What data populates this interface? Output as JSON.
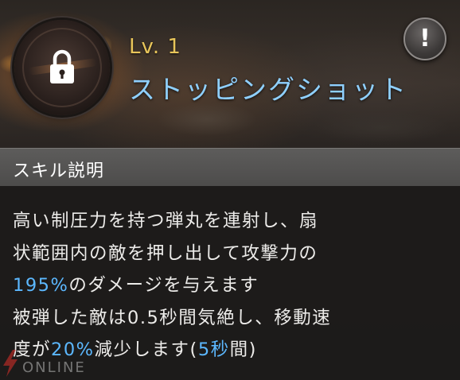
{
  "skill": {
    "level": "Lv. 1",
    "name": "ストッピングショット",
    "icon": "lock-icon",
    "locked": true
  },
  "info_button": {
    "label": "!",
    "icon": "exclamation-icon"
  },
  "section": {
    "header": "スキル説明"
  },
  "description": {
    "line1": "高い制圧力を持つ弾丸を連射し、扇",
    "line2": "状範囲内の敵を押し出して攻撃力の",
    "line3_value": "195%",
    "line3_rest": "のダメージを与えます",
    "line4": "被弾した敵は0.5秒間気絶し、移動速",
    "line5_pre": "度が",
    "line5_value": "20%",
    "line5_mid": "減少します(",
    "line5_value2": "5秒",
    "line5_post": "間)"
  },
  "watermark": {
    "text": "ONLINE"
  },
  "colors": {
    "level": "#e8c55a",
    "skill_name": "#8fd0ff",
    "highlight": "#5cb8ff",
    "header_bg": "#555453",
    "body_text": "#ecebe9"
  }
}
